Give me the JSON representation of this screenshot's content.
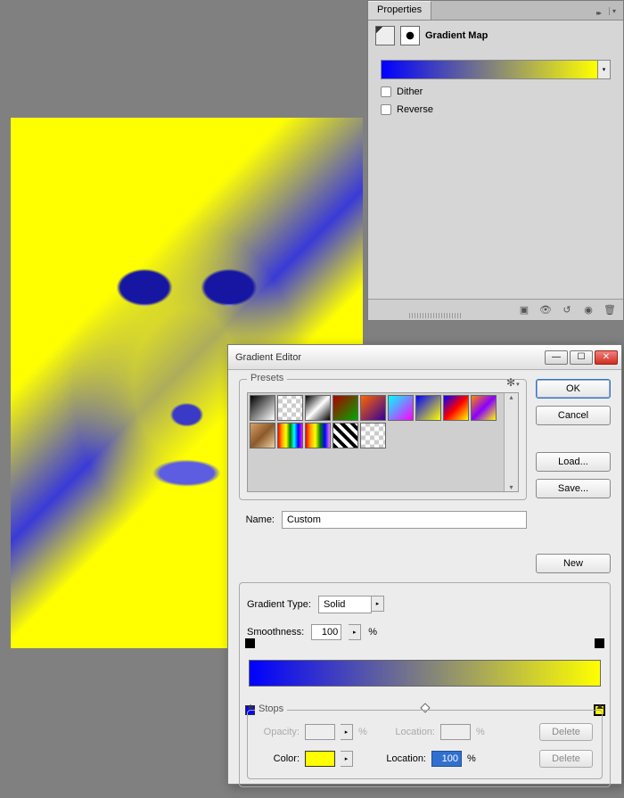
{
  "properties_panel": {
    "tab": "Properties",
    "title": "Gradient Map",
    "dither_label": "Dither",
    "reverse_label": "Reverse",
    "gradient": {
      "from": "#0000ff",
      "to": "#ffff00"
    }
  },
  "gradient_editor": {
    "title": "Gradient Editor",
    "buttons": {
      "ok": "OK",
      "cancel": "Cancel",
      "load": "Load...",
      "save": "Save...",
      "new": "New"
    },
    "presets_label": "Presets",
    "name_label": "Name:",
    "name_value": "Custom",
    "gradient_type_label": "Gradient Type:",
    "gradient_type_value": "Solid",
    "smoothness_label": "Smoothness:",
    "smoothness_value": "100",
    "pct": "%",
    "stops_label": "Stops",
    "opacity_label": "Opacity:",
    "color_label": "Color:",
    "location_label": "Location:",
    "location_value": "100",
    "delete_label": "Delete",
    "color_stops": [
      {
        "position": 0,
        "color": "#0000ff"
      },
      {
        "position": 100,
        "color": "#ffff00"
      }
    ],
    "opacity_stops": [
      {
        "position": 0,
        "opacity": 100
      },
      {
        "position": 100,
        "opacity": 100
      }
    ]
  },
  "presets_css": [
    "linear-gradient(135deg,#000,#fff)",
    "repeating-conic-gradient(#ccc 0 25%,#fff 0 50%) 0/10px 10px,linear-gradient(135deg,#000,transparent)",
    "linear-gradient(135deg,#000,#fff 50%,#000)",
    "linear-gradient(135deg,#a00,#0a0)",
    "linear-gradient(135deg,#f60,#309)",
    "linear-gradient(135deg,#0ff,#f0f)",
    "linear-gradient(135deg,#00f,#ff0)",
    "linear-gradient(135deg,#00f,#f00,#ff0)",
    "linear-gradient(135deg,#f80,#80f,#ff0)",
    "linear-gradient(135deg,#d9a066,#8b5a2b,#f0d0a0)",
    "linear-gradient(90deg,red,orange,yellow,green,cyan,blue,magenta)",
    "linear-gradient(90deg,red,orange,yellow,green,blue,violet)",
    "repeating-linear-gradient(45deg,#000 0 4px,#fff 4px 8px)",
    "repeating-conic-gradient(#ccc 0 25%,#fff 0 50%) 0/10px 10px"
  ]
}
